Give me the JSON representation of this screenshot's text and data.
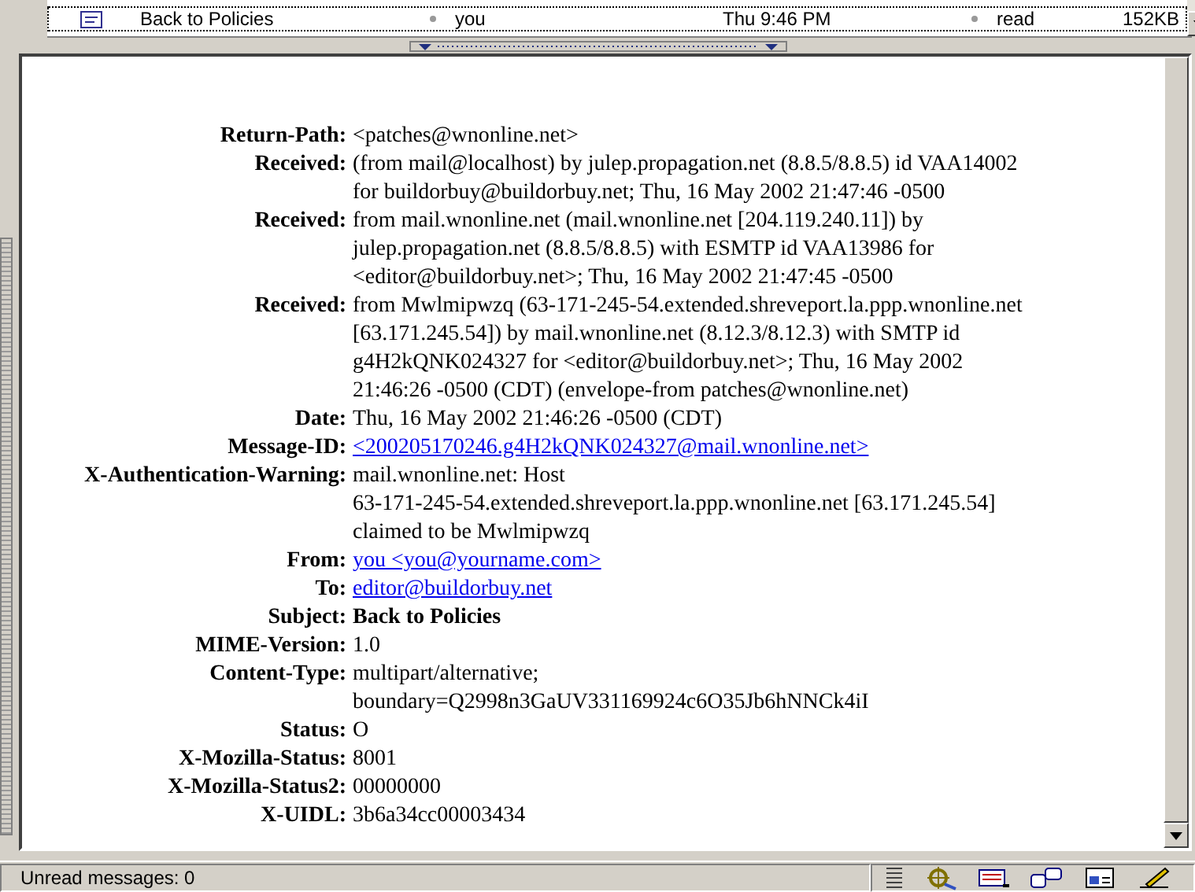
{
  "message_list": {
    "rows": [
      {
        "subject": "Back to Policies",
        "sender": "you",
        "date": "Thu 9:46 PM",
        "status": "read",
        "size": "152KB",
        "selected": true
      }
    ]
  },
  "headers": [
    {
      "name": "Return-Path:",
      "kind": "text",
      "lines": [
        "<patches@wnonline.net>"
      ]
    },
    {
      "name": "Received:",
      "kind": "text",
      "lines": [
        "(from mail@localhost) by julep.propagation.net (8.8.5/8.8.5) id VAA14002",
        "for buildorbuy@buildorbuy.net; Thu, 16 May 2002 21:47:46 -0500"
      ]
    },
    {
      "name": "Received:",
      "kind": "text",
      "lines": [
        "from mail.wnonline.net (mail.wnonline.net [204.119.240.11]) by",
        "julep.propagation.net (8.8.5/8.8.5) with ESMTP id VAA13986 for",
        "<editor@buildorbuy.net>; Thu, 16 May 2002 21:47:45 -0500"
      ]
    },
    {
      "name": "Received:",
      "kind": "text",
      "lines": [
        "from Mwlmipwzq (63-171-245-54.extended.shreveport.la.ppp.wnonline.net",
        "[63.171.245.54]) by mail.wnonline.net (8.12.3/8.12.3) with SMTP id",
        "g4H2kQNK024327 for <editor@buildorbuy.net>; Thu, 16 May 2002",
        "21:46:26 -0500 (CDT) (envelope-from patches@wnonline.net)"
      ]
    },
    {
      "name": "Date:",
      "kind": "text",
      "lines": [
        "Thu, 16 May 2002 21:46:26 -0500 (CDT)"
      ]
    },
    {
      "name": "Message-ID:",
      "kind": "link",
      "lines": [
        "<200205170246.g4H2kQNK024327@mail.wnonline.net>"
      ]
    },
    {
      "name": "X-Authentication-Warning:",
      "kind": "text",
      "lines": [
        "mail.wnonline.net: Host",
        "63-171-245-54.extended.shreveport.la.ppp.wnonline.net [63.171.245.54]",
        "claimed to be Mwlmipwzq"
      ]
    },
    {
      "name": "From:",
      "kind": "link",
      "lines": [
        "you <you@yourname.com>"
      ]
    },
    {
      "name": "To:",
      "kind": "link",
      "lines": [
        "editor@buildorbuy.net"
      ]
    },
    {
      "name": "Subject:",
      "kind": "bold",
      "lines": [
        "Back to Policies"
      ]
    },
    {
      "name": "MIME-Version:",
      "kind": "text",
      "lines": [
        "1.0"
      ]
    },
    {
      "name": "Content-Type:",
      "kind": "text",
      "lines": [
        "multipart/alternative;",
        "boundary=Q2998n3GaUV331169924c6O35Jb6hNNCk4iI"
      ]
    },
    {
      "name": "Status:",
      "kind": "text",
      "lines": [
        "O"
      ]
    },
    {
      "name": "X-Mozilla-Status:",
      "kind": "text",
      "lines": [
        "8001"
      ]
    },
    {
      "name": "X-Mozilla-Status2:",
      "kind": "text",
      "lines": [
        "00000000"
      ]
    },
    {
      "name": "X-UIDL:",
      "kind": "text",
      "lines": [
        "3b6a34cc00003434"
      ]
    }
  ],
  "status_bar": {
    "text": "Unread messages: 0"
  }
}
